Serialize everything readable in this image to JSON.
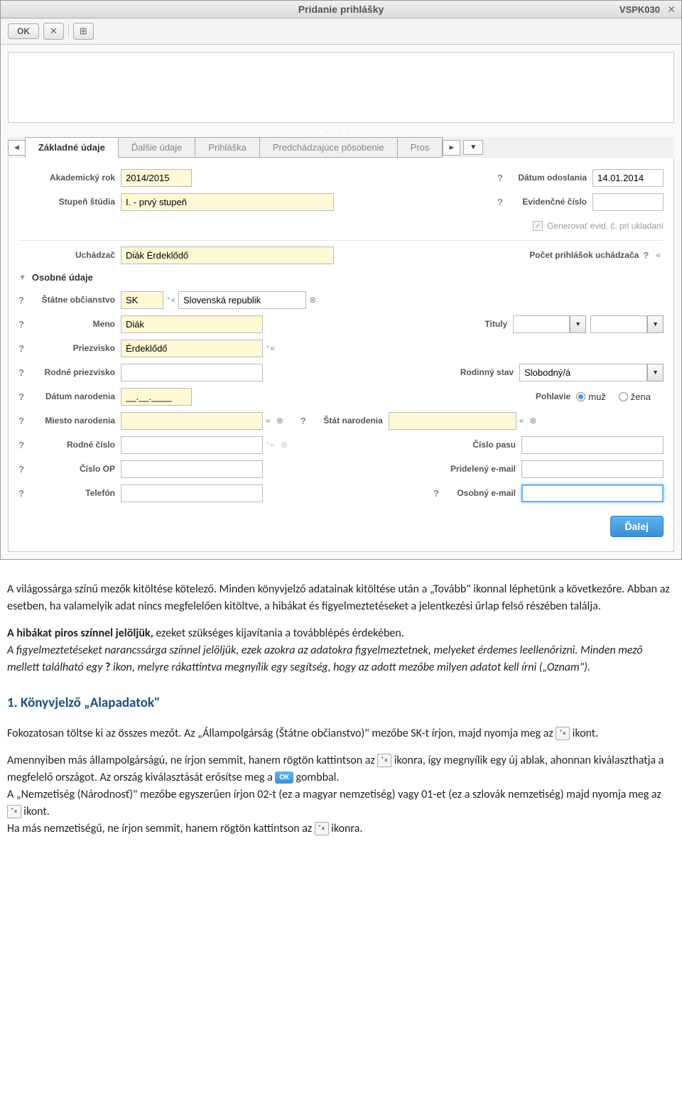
{
  "titlebar": {
    "title": "Pridanie prihlášky",
    "code": "VSPK030"
  },
  "toolbar": {
    "ok": "OK"
  },
  "tabs": {
    "t1": "Základné údaje",
    "t2": "Ďalšie údaje",
    "t3": "Prihláška",
    "t4": "Predchádzajúce pôsobenie",
    "t5": "Pros"
  },
  "form": {
    "akademicky_rok_label": "Akademický rok",
    "akademicky_rok_value": "2014/2015",
    "datum_odoslania_label": "Dátum odoslania",
    "datum_odoslania_value": "14.01.2014",
    "stupen_label": "Stupeň štúdia",
    "stupen_value": "I. - prvý stupeň",
    "evidencne_label": "Evidenčné číslo",
    "generovat_label": "Generovať evid. č. pri ukladaní",
    "uchadzac_label": "Uchádzač",
    "uchadzac_value": "Diák Érdeklődő",
    "pocet_label": "Počet prihlášok uchádzača",
    "osobne_section": "Osobné údaje",
    "obcianstvo_label": "Štátne občianstvo",
    "obcianstvo_code": "SK",
    "obcianstvo_name": "Slovenská republik",
    "meno_label": "Meno",
    "meno_value": "Diák",
    "tituly_label": "Tituly",
    "priezvisko_label": "Priezvisko",
    "priezvisko_value": "Érdeklődő",
    "rodne_priezvisko_label": "Rodné priezvisko",
    "rodinny_stav_label": "Rodinný stav",
    "rodinny_stav_value": "Slobodný/á",
    "datum_narodenia_label": "Dátum narodenia",
    "pohlavie_label": "Pohlavie",
    "pohlavie_muz": "muž",
    "pohlavie_zena": "žena",
    "miesto_narodenia_label": "Miesto narodenia",
    "stat_narodenia_label": "Štát narodenia",
    "rodne_cislo_label": "Rodné číslo",
    "cislo_pasu_label": "Číslo pasu",
    "cislo_op_label": "Číslo OP",
    "prideleny_email_label": "Pridelený e-mail",
    "telefon_label": "Telefón",
    "osobny_email_label": "Osobný e-mail",
    "next_button": "Ďalej"
  },
  "doc": {
    "p1a": "A világossárga színű mezők kitöltése kötelező. Minden könyvjelző adatainak kitöltése után a „Tovább\"  ikonnal léphetünk a következőre.",
    "p1b": "Abban az esetben, ha valamelyik adat nincs megfelelően kitöltve, a hibákat és figyelmeztetéseket a jelentkezési űrlap felső részében találja.",
    "p2a": "A hibákat piros színnel jelöljük, ",
    "p2b": "ezeket szükséges kijavítania a továbblépés érdekében.",
    "p3a": "A figyelmeztetéseket narancssárga színnel jelöljük, ezek azokra az adatokra figyelmeztetnek, melyeket érdemes leellenőrizni. Minden mező mellett található egy ",
    "p3b": " ikon, melyre rákattintva megnyílik egy segítség, hogy az adott mezőbe milyen adatot kell írni („Oznam\").",
    "h1": "1. Könyvjelző „Alapadatok\"",
    "p4a": "Fokozatosan töltse ki az összes mezőt. Az „Állampolgárság (Štátne občianstvo)\" mezőbe SK-t írjon, majd nyomja meg az ",
    "p4b": " ikont.",
    "p5a": "Amennyiben más állampolgárságú, ne írjon semmit, hanem rögtön kattintson az ",
    "p5b": " ikonra, így megnyílik egy új ablak, ahonnan kiválaszthatja a megfelelő országot. Az ország kiválasztását erősítse meg a ",
    "p5c": " gombbal.",
    "p6a": "A „Nemzetiség (Národnosť)\" mezőbe egyszerűen írjon 02-t (ez a magyar nemzetiség) vagy 01-et (ez a szlovák nemzetiség) majd nyomja meg az ",
    "p6b": " ikont.",
    "p7a": "Ha más nemzetiségű, ne írjon semmit, hanem rögtön kattintson az ",
    "p7b": " ikonra.",
    "ok_text": "OK"
  }
}
